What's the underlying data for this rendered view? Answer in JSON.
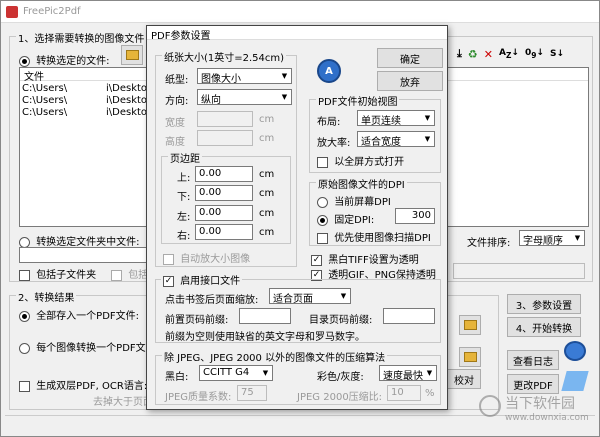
{
  "app": {
    "title": "FreePic2Pdf",
    "section1_title": "1、选择需要转换的图像文件",
    "radio_selected_files": "转换选定的文件:",
    "file_col_header": "文件",
    "files": [
      "C:\\Users\\",
      "C:\\Users\\",
      "C:\\Users\\"
    ],
    "file_suffix": "i\\Deskto",
    "radio_folder": "转换选定文件夹中文件:",
    "chk_subfolders": "包括子文件夹",
    "chk_other_partial": "包括",
    "sort_label": "文件排序:",
    "sort_value": "字母顺序",
    "section2_title": "2、转换结果",
    "radio_all_one": "全部存入一个PDF文件:",
    "radio_each_one": "每个图像转换一个PDF文件",
    "chk_ocr": "生成双层PDF, OCR语言:",
    "bottom_note": "去掉大于页面",
    "btn_proof": "校对",
    "btn_params": "3、参数设置",
    "btn_start": "4、开始转换",
    "btn_log": "查看日志",
    "btn_change_pdf": "更改PDF",
    "watermark": "当下软件园",
    "watermark_url": "www.downxia.com"
  },
  "dialog": {
    "title": "PDF参数设置",
    "btn_ok": "确定",
    "btn_cancel": "放弃",
    "paper_group": "纸张大小(1英寸=2.54cm)",
    "paper_label": "纸型:",
    "paper_value": "图像大小",
    "orient_label": "方向:",
    "orient_value": "纵向",
    "width_label": "宽度",
    "height_label": "高度",
    "unit_cm": "cm",
    "margin_group": "页边距",
    "margin_top": "上:",
    "margin_bottom": "下:",
    "margin_left": "左:",
    "margin_right": "右:",
    "margin_value": "0.00",
    "auto_enlarge": "自动放大小图像",
    "view_group": "PDF文件初始视图",
    "layout_label": "布局:",
    "layout_value": "单页连续",
    "zoom_label": "放大率:",
    "zoom_value": "适合宽度",
    "fullscreen": "以全屏方式打开",
    "dpi_group": "原始图像文件的DPI",
    "dpi_current": "当前屏幕DPI",
    "dpi_fixed": "固定DPI:",
    "dpi_value": "300",
    "dpi_prefer_scan": "优先使用图像扫描DPI",
    "tiff_transparent": "黑白TIFF设置为透明",
    "gif_transparent": "透明GIF、PNG保持透明",
    "interface_enable": "启用接口文件",
    "bookmark_zoom_label": "点击书签后页面缩放:",
    "bookmark_zoom_value": "适合页面",
    "prefix_front_label": "前置页码前缀:",
    "prefix_toc_label": "目录页码前缀:",
    "prefix_note": "前缀为空则使用缺省的英文字母和罗马数字。",
    "compress_group": "除 JPEG、JPEG 2000 以外的图像文件的压缩算法",
    "bw_label": "黑白:",
    "bw_value": "CCITT G4",
    "color_label": "彩色/灰度:",
    "color_value": "速度最快",
    "jpeg_quality_label": "JPEG质量系数:",
    "jpeg_quality_value": "75",
    "jpeg2000_label": "JPEG 2000压缩比:",
    "jpeg2000_value": "10",
    "percent": "%"
  }
}
